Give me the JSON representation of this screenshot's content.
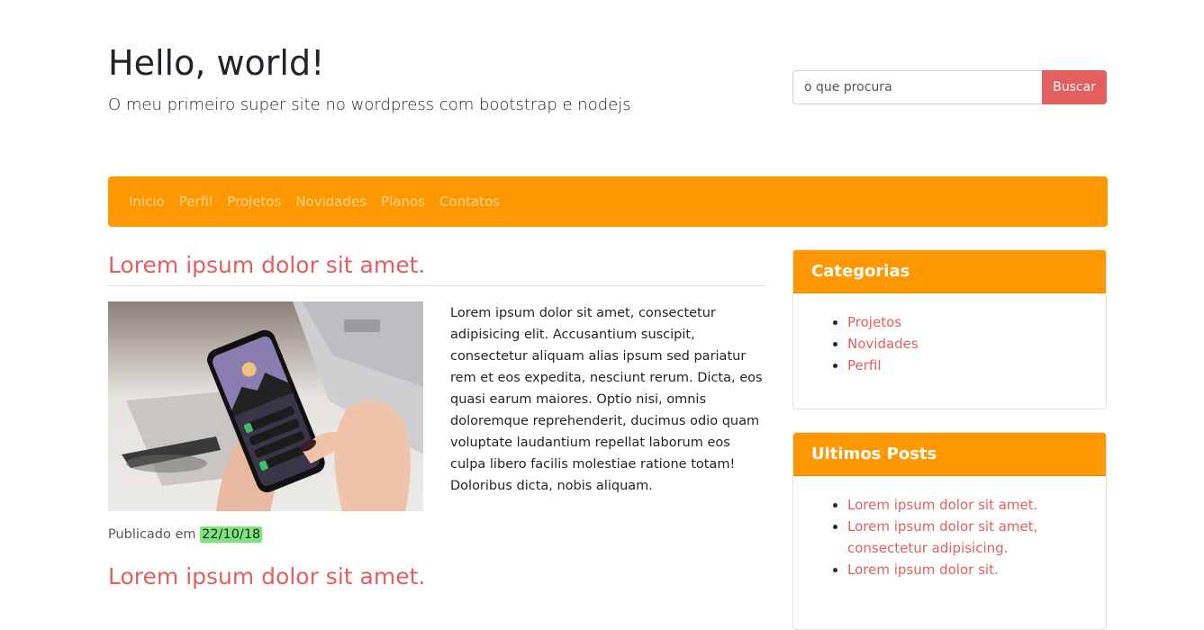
{
  "header": {
    "title": "Hello, world!",
    "subtitle": "O meu primeiro super site no wordpress com bootstrap e nodejs"
  },
  "search": {
    "placeholder": "o que procura",
    "button_label": "Buscar"
  },
  "nav": {
    "items": [
      "Inicio",
      "Perfil",
      "Projetos",
      "Novidades",
      "Planos",
      "Contatos"
    ]
  },
  "posts": [
    {
      "title": "Lorem ipsum dolor sit amet.",
      "body": "Lorem ipsum dolor sit amet, consectetur adipisicing elit. Accusantium suscipit, consectetur aliquam alias ipsum sed pariatur rem et eos expedita, nesciunt rerum. Dicta, eos quasi earum maiores. Optio nisi, omnis doloremque reprehenderit, ducimus odio quam voluptate laudantium repellat laborum eos culpa libero facilis molestiae ratione totam! Doloribus dicta, nobis aliquam.",
      "meta_label": "Publicado em",
      "date": "22/10/18"
    },
    {
      "title": "Lorem ipsum dolor sit amet."
    }
  ],
  "sidebar": {
    "categorias": {
      "title": "Categorias",
      "items": [
        "Projetos",
        "Novidades",
        "Perfil"
      ]
    },
    "ultimos_posts": {
      "title": "Ultimos Posts",
      "items": [
        "Lorem ipsum dolor sit amet.",
        "Lorem ipsum dolor sit amet, consectetur adipisicing.",
        "Lorem ipsum dolor sit."
      ]
    }
  },
  "colors": {
    "accent_orange": "#ff9800",
    "link_red": "#e45e5e",
    "date_highlight": "#7ee57a"
  }
}
